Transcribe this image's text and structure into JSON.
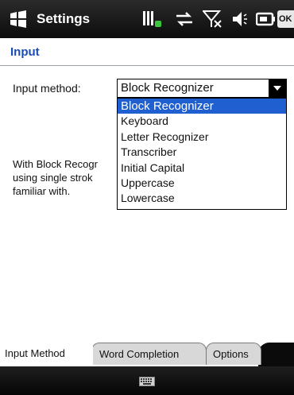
{
  "titlebar": {
    "title": "Settings",
    "ok_label": "OK",
    "icons": [
      "windows-start-icon",
      "signal-battery-icon",
      "sync-arrows-icon",
      "no-signal-icon",
      "volume-icon",
      "battery-icon"
    ]
  },
  "page": {
    "title": "Input"
  },
  "input_method": {
    "label": "Input method:",
    "selected": "Block Recognizer",
    "options": [
      "Block Recognizer",
      "Keyboard",
      "Letter Recognizer",
      "Transcriber",
      "Initial Capital",
      "Uppercase",
      "Lowercase"
    ]
  },
  "description": {
    "text": "With Block Recogr\nusing single strok\nfamiliar with."
  },
  "tabs": [
    {
      "label": "Input Method",
      "active": true
    },
    {
      "label": "Word Completion",
      "active": false
    },
    {
      "label": "Options",
      "active": false
    }
  ],
  "colors": {
    "accent": "#1a4db3",
    "selection": "#1f5fcf",
    "titlebar": "#1a1a1a"
  }
}
